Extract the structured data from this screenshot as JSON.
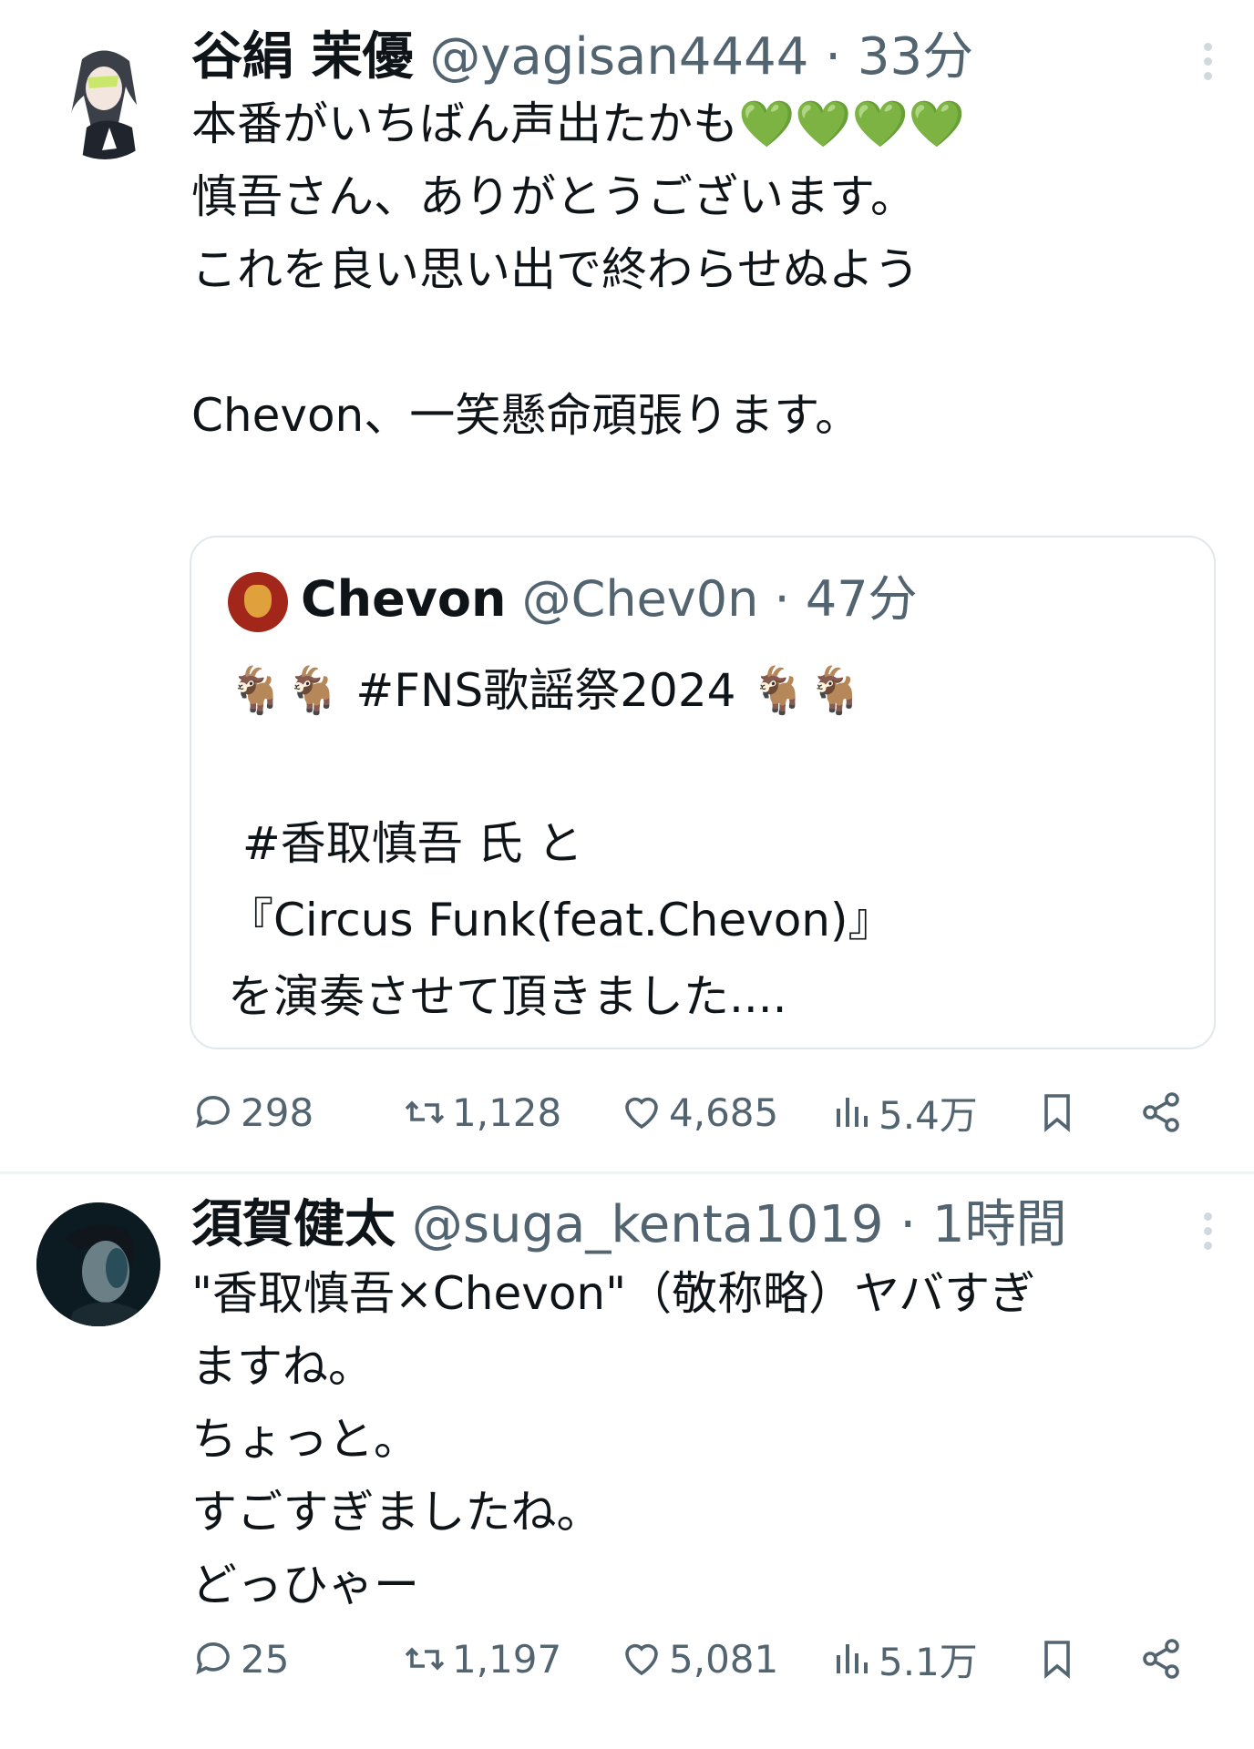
{
  "tweet1": {
    "display_name": "谷絹 茉優",
    "handle": "@yagisan4444",
    "separator": "·",
    "time": "33分",
    "body_line1": "本番がいちばん声出たかも",
    "hearts": "💚💚💚💚",
    "body_rest": "\n慎吾さん、ありがとうございます。\nこれを良い思い出で終わらせぬよう\n\nChevon、一笑懸命頑張ります。",
    "quote": {
      "display_name": "Chevon",
      "handle": "@Chev0n",
      "separator": "·",
      "time": "47分",
      "body": "🐐🐐 #FNS歌謡祭2024 🐐🐐\n\n #香取慎吾 氏 と\n『Circus Funk(feat.Chevon)』\nを演奏させて頂きました...."
    },
    "actions": {
      "replies": "298",
      "retweets": "1,128",
      "likes": "4,685",
      "views": "5.4万"
    }
  },
  "tweet2": {
    "display_name": "須賀健太",
    "handle": "@suga_kenta1019",
    "separator": "·",
    "time": "1時間",
    "body": "\"香取慎吾×Chevon\"（敬称略）ヤバすぎ\nますね。\nちょっと。\nすごすぎましたね。\nどっひゃー",
    "actions": {
      "replies": "25",
      "retweets": "1,197",
      "likes": "5,081",
      "views": "5.1万"
    }
  },
  "icons": [
    "more-icon",
    "reply-icon",
    "retweet-icon",
    "like-icon",
    "views-icon",
    "bookmark-icon",
    "share-icon"
  ],
  "colors": {
    "text": "#0f1419",
    "meta": "#536471",
    "heart": "#5cb533",
    "border": "#e1e8ed"
  }
}
